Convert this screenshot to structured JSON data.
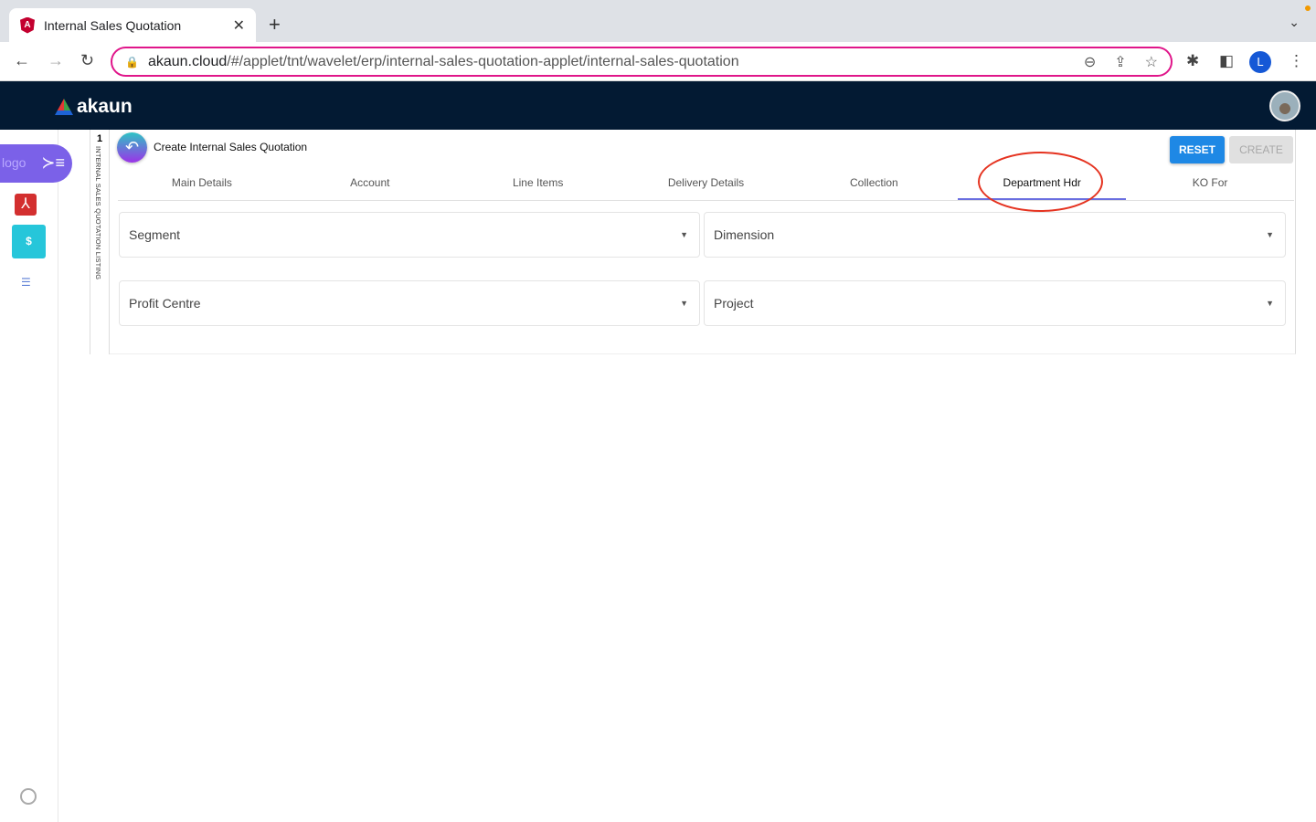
{
  "browser": {
    "tab_title": "Internal Sales Quotation",
    "url_host": "akaun.cloud",
    "url_path": "/#/applet/tnt/wavelet/erp/internal-sales-quotation-applet/internal-sales-quotation",
    "profile_initial": "L"
  },
  "app": {
    "brand": "akaun",
    "sidebar_logo_alt": "logo"
  },
  "listing": {
    "count": "1",
    "label": "INTERNAL SALES QUOTATION LISTING"
  },
  "page": {
    "title": "Create Internal Sales Quotation",
    "reset_label": "RESET",
    "create_label": "CREATE"
  },
  "tabs": [
    {
      "label": "Main Details"
    },
    {
      "label": "Account"
    },
    {
      "label": "Line Items"
    },
    {
      "label": "Delivery Details"
    },
    {
      "label": "Collection"
    },
    {
      "label": "Department Hdr"
    },
    {
      "label": "KO For"
    }
  ],
  "fields": {
    "segment": "Segment",
    "dimension": "Dimension",
    "profit_centre": "Profit Centre",
    "project": "Project"
  },
  "colors": {
    "header": "#031a33",
    "accent": "#1e88e5",
    "highlight": "#e53320"
  }
}
